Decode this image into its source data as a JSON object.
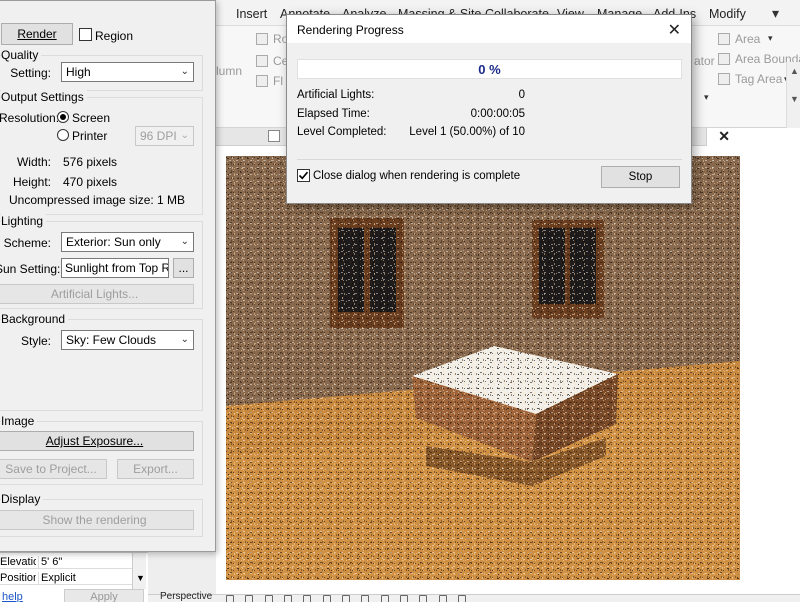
{
  "ribbon": {
    "tabs": [
      "Insert",
      "Annotate",
      "Analyze",
      "Massing & Site",
      "Collaborate",
      "View",
      "Manage",
      "Add-Ins",
      "Modify"
    ],
    "items": {
      "column": "lumn",
      "room_frag_1": "Ro",
      "room_frag_2": "Ce",
      "room_frag_3": "Fl",
      "ator": "ator",
      "area": "Area",
      "area_boundary": "Area Boundar",
      "tag_area": "Tag Area"
    }
  },
  "render_dialog": {
    "render_button": "Render",
    "region_label": "Region",
    "quality_group": "Quality",
    "setting_label": "Setting:",
    "setting_value": "High",
    "output_group": "Output Settings",
    "resolution_label": "Resolution:",
    "screen_label": "Screen",
    "printer_label": "Printer",
    "dpi_value": "96 DPI",
    "width_label": "Width:",
    "width_value": "576 pixels",
    "height_label": "Height:",
    "height_value": "470 pixels",
    "uncompressed_label": "Uncompressed image size:",
    "uncompressed_value": "1 MB",
    "lighting_group": "Lighting",
    "scheme_label": "Scheme:",
    "scheme_value": "Exterior: Sun only",
    "sun_label": "Sun Setting:",
    "sun_value": "Sunlight from Top Righ",
    "sun_browse": "...",
    "artificial_lights": "Artificial Lights...",
    "background_group": "Background",
    "style_label": "Style:",
    "style_value": "Sky: Few Clouds",
    "image_group": "Image",
    "adjust_exposure": "Adjust Exposure...",
    "save_to_project": "Save to Project...",
    "export": "Export...",
    "display_group": "Display",
    "show_rendering": "Show the rendering"
  },
  "properties": {
    "rows": [
      {
        "key": "Elevation",
        "value": "5'  6\""
      },
      {
        "key": "Position",
        "value": "Explicit"
      }
    ],
    "help": "help",
    "apply": "Apply"
  },
  "progress_dialog": {
    "title": "Rendering Progress",
    "percent_text": "0 %",
    "percent": 0,
    "artificial_lights_label": "Artificial Lights:",
    "artificial_lights_value": "0",
    "elapsed_label": "Elapsed Time:",
    "elapsed_value": "0:00:00:05",
    "level_label": "Level Completed:",
    "level_value": "Level 1 (50.00%) of 10",
    "close_checkbox_label": "Close dialog when rendering is complete",
    "close_checked": true,
    "stop_button": "Stop"
  },
  "view": {
    "view_style": "Perspective"
  },
  "colors": {
    "progress_fill": "#06b025",
    "percent_text": "#1a2a88",
    "render_floor": "#c8883e",
    "render_wall": "#8a6a4e"
  }
}
